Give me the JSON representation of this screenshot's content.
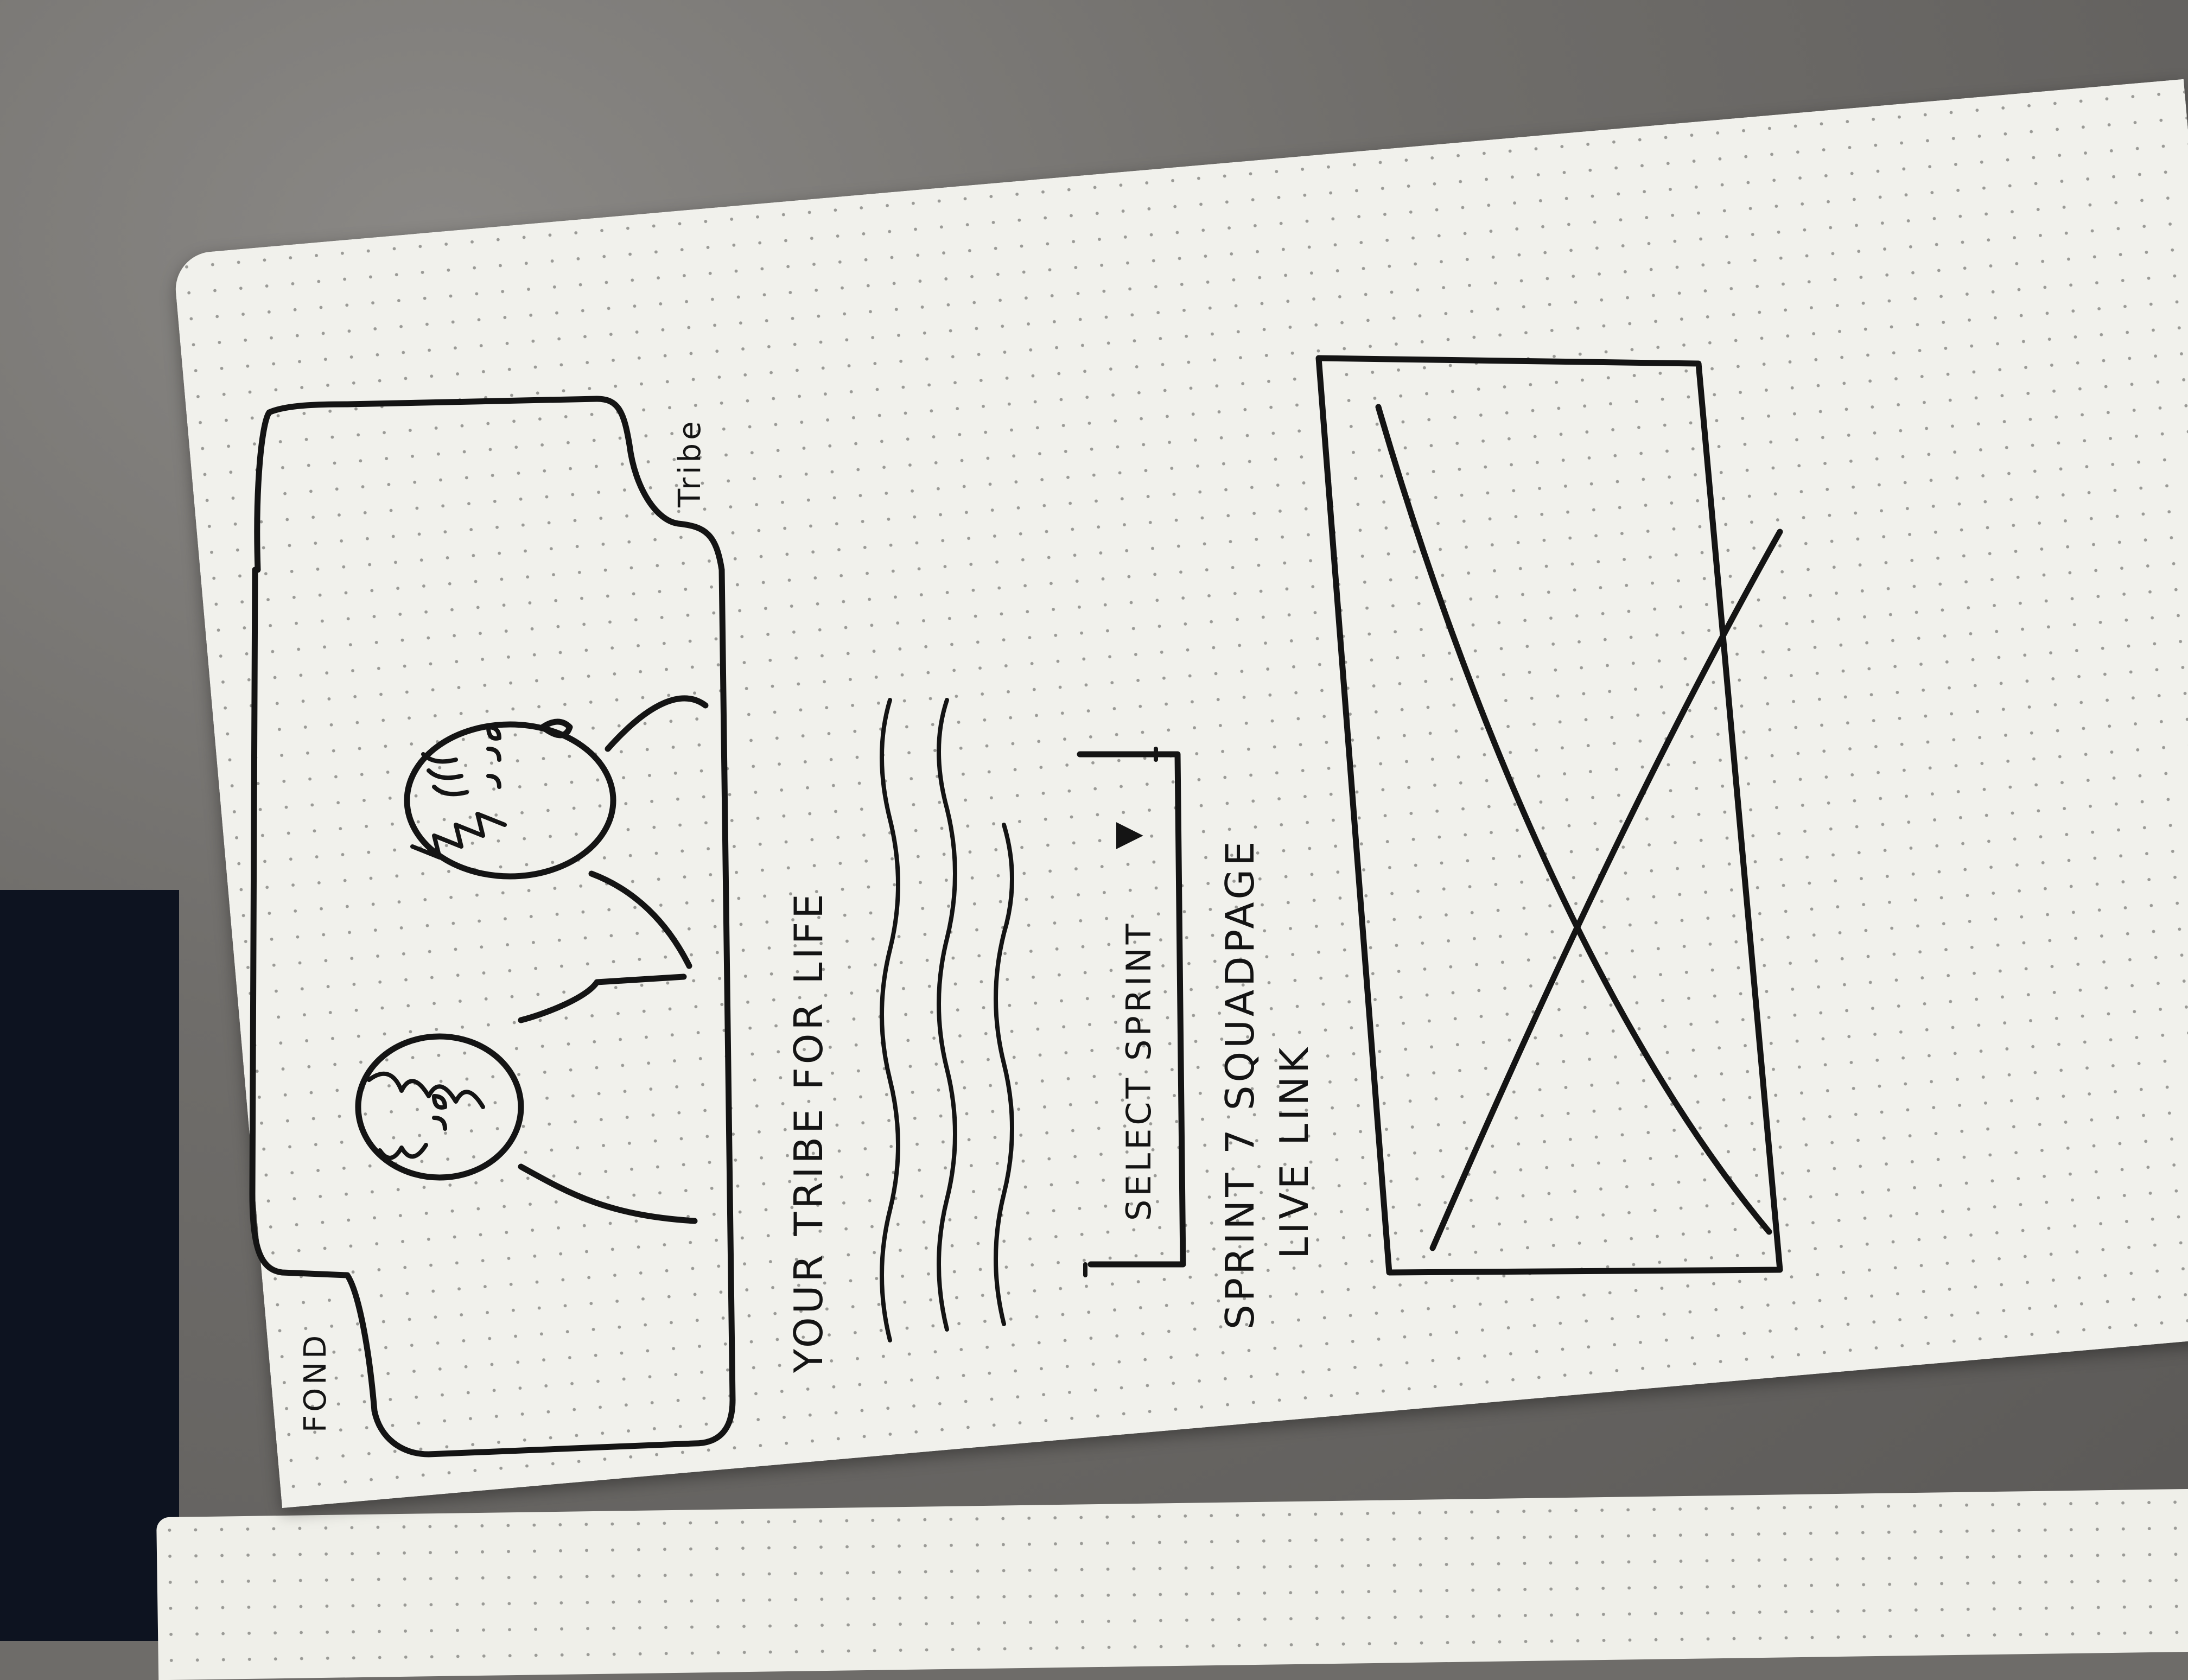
{
  "sketch": {
    "header_left_label": "FOND",
    "header_right_label": "Tribe",
    "tagline": "YOUR TRIBE FOR LIFE",
    "select_dropdown_label": "SELECT SPRINT",
    "dropdown_arrow_icon": "triangle-down-icon",
    "sprint_link_line1": "SPRINT 7 SQUADPAGE",
    "sprint_link_line2": "LIVE LINK",
    "image_placeholder_icon": "image-placeholder-x-icon",
    "hero_icons": [
      "person-avatar-icon",
      "person-avatar-icon"
    ]
  },
  "colors": {
    "ink": "#141414",
    "paper": "#f1f1ec",
    "table": "#6e6c69"
  }
}
